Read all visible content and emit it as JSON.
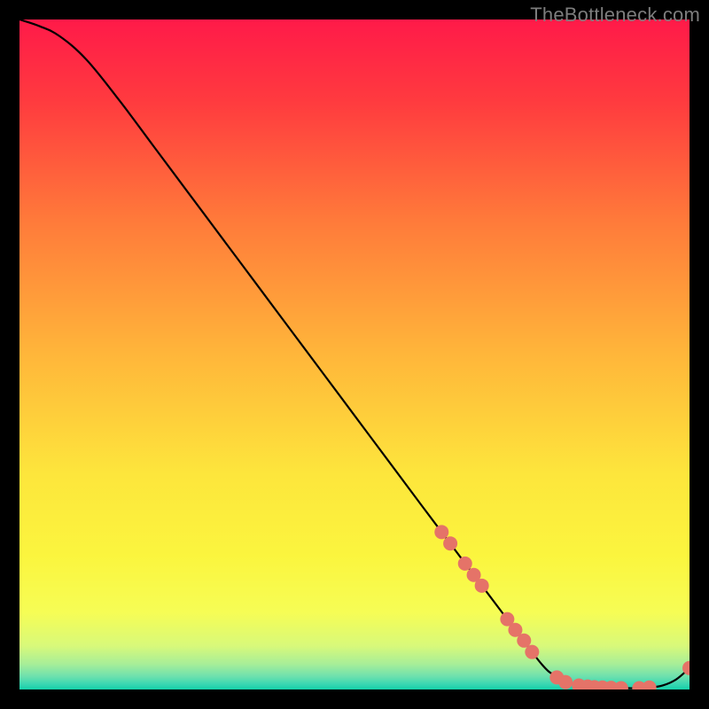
{
  "watermark": "TheBottleneck.com",
  "chart_data": {
    "type": "line",
    "title": "",
    "xlabel": "",
    "ylabel": "",
    "x_range": [
      0,
      100
    ],
    "y_range": [
      0,
      100
    ],
    "curve": {
      "name": "bottleneck-curve",
      "x": [
        0,
        3,
        6,
        10,
        15,
        20,
        25,
        30,
        35,
        40,
        45,
        50,
        55,
        60,
        63,
        66,
        70,
        74,
        78,
        80,
        82,
        84,
        86,
        88,
        90,
        92,
        94,
        96,
        98,
        100
      ],
      "y": [
        100,
        99,
        97.5,
        94,
        87.8,
        81.1,
        74.4,
        67.7,
        61.0,
        54.3,
        47.6,
        40.9,
        34.2,
        27.5,
        23.5,
        19.5,
        14.2,
        8.9,
        3.7,
        2.0,
        1.0,
        0.5,
        0.3,
        0.2,
        0.2,
        0.2,
        0.3,
        0.6,
        1.5,
        3.2
      ]
    },
    "markers": {
      "name": "highlighted-points",
      "color": "#e57368",
      "radius_px": 8,
      "points": [
        {
          "x": 63.0,
          "y": 23.5
        },
        {
          "x": 64.3,
          "y": 21.8
        },
        {
          "x": 66.5,
          "y": 18.8
        },
        {
          "x": 67.8,
          "y": 17.1
        },
        {
          "x": 69.0,
          "y": 15.5
        },
        {
          "x": 72.8,
          "y": 10.5
        },
        {
          "x": 74.0,
          "y": 8.9
        },
        {
          "x": 75.3,
          "y": 7.3
        },
        {
          "x": 76.5,
          "y": 5.6
        },
        {
          "x": 80.2,
          "y": 1.8
        },
        {
          "x": 81.5,
          "y": 1.1
        },
        {
          "x": 83.5,
          "y": 0.6
        },
        {
          "x": 84.8,
          "y": 0.45
        },
        {
          "x": 85.8,
          "y": 0.35
        },
        {
          "x": 87.0,
          "y": 0.3
        },
        {
          "x": 88.3,
          "y": 0.25
        },
        {
          "x": 89.8,
          "y": 0.2
        },
        {
          "x": 92.5,
          "y": 0.2
        },
        {
          "x": 94.0,
          "y": 0.3
        },
        {
          "x": 100.0,
          "y": 3.2
        }
      ]
    },
    "background_gradient": {
      "type": "vertical",
      "stops": [
        {
          "offset": 0.0,
          "color": "#ff1a49"
        },
        {
          "offset": 0.12,
          "color": "#ff3a3f"
        },
        {
          "offset": 0.3,
          "color": "#ff7a3a"
        },
        {
          "offset": 0.5,
          "color": "#ffb63a"
        },
        {
          "offset": 0.68,
          "color": "#fde63c"
        },
        {
          "offset": 0.8,
          "color": "#fbf53e"
        },
        {
          "offset": 0.885,
          "color": "#f6fd55"
        },
        {
          "offset": 0.935,
          "color": "#d8f97a"
        },
        {
          "offset": 0.962,
          "color": "#a7ee98"
        },
        {
          "offset": 0.98,
          "color": "#6fe1ad"
        },
        {
          "offset": 0.992,
          "color": "#3ad7b2"
        },
        {
          "offset": 1.0,
          "color": "#14d0a9"
        }
      ]
    }
  }
}
